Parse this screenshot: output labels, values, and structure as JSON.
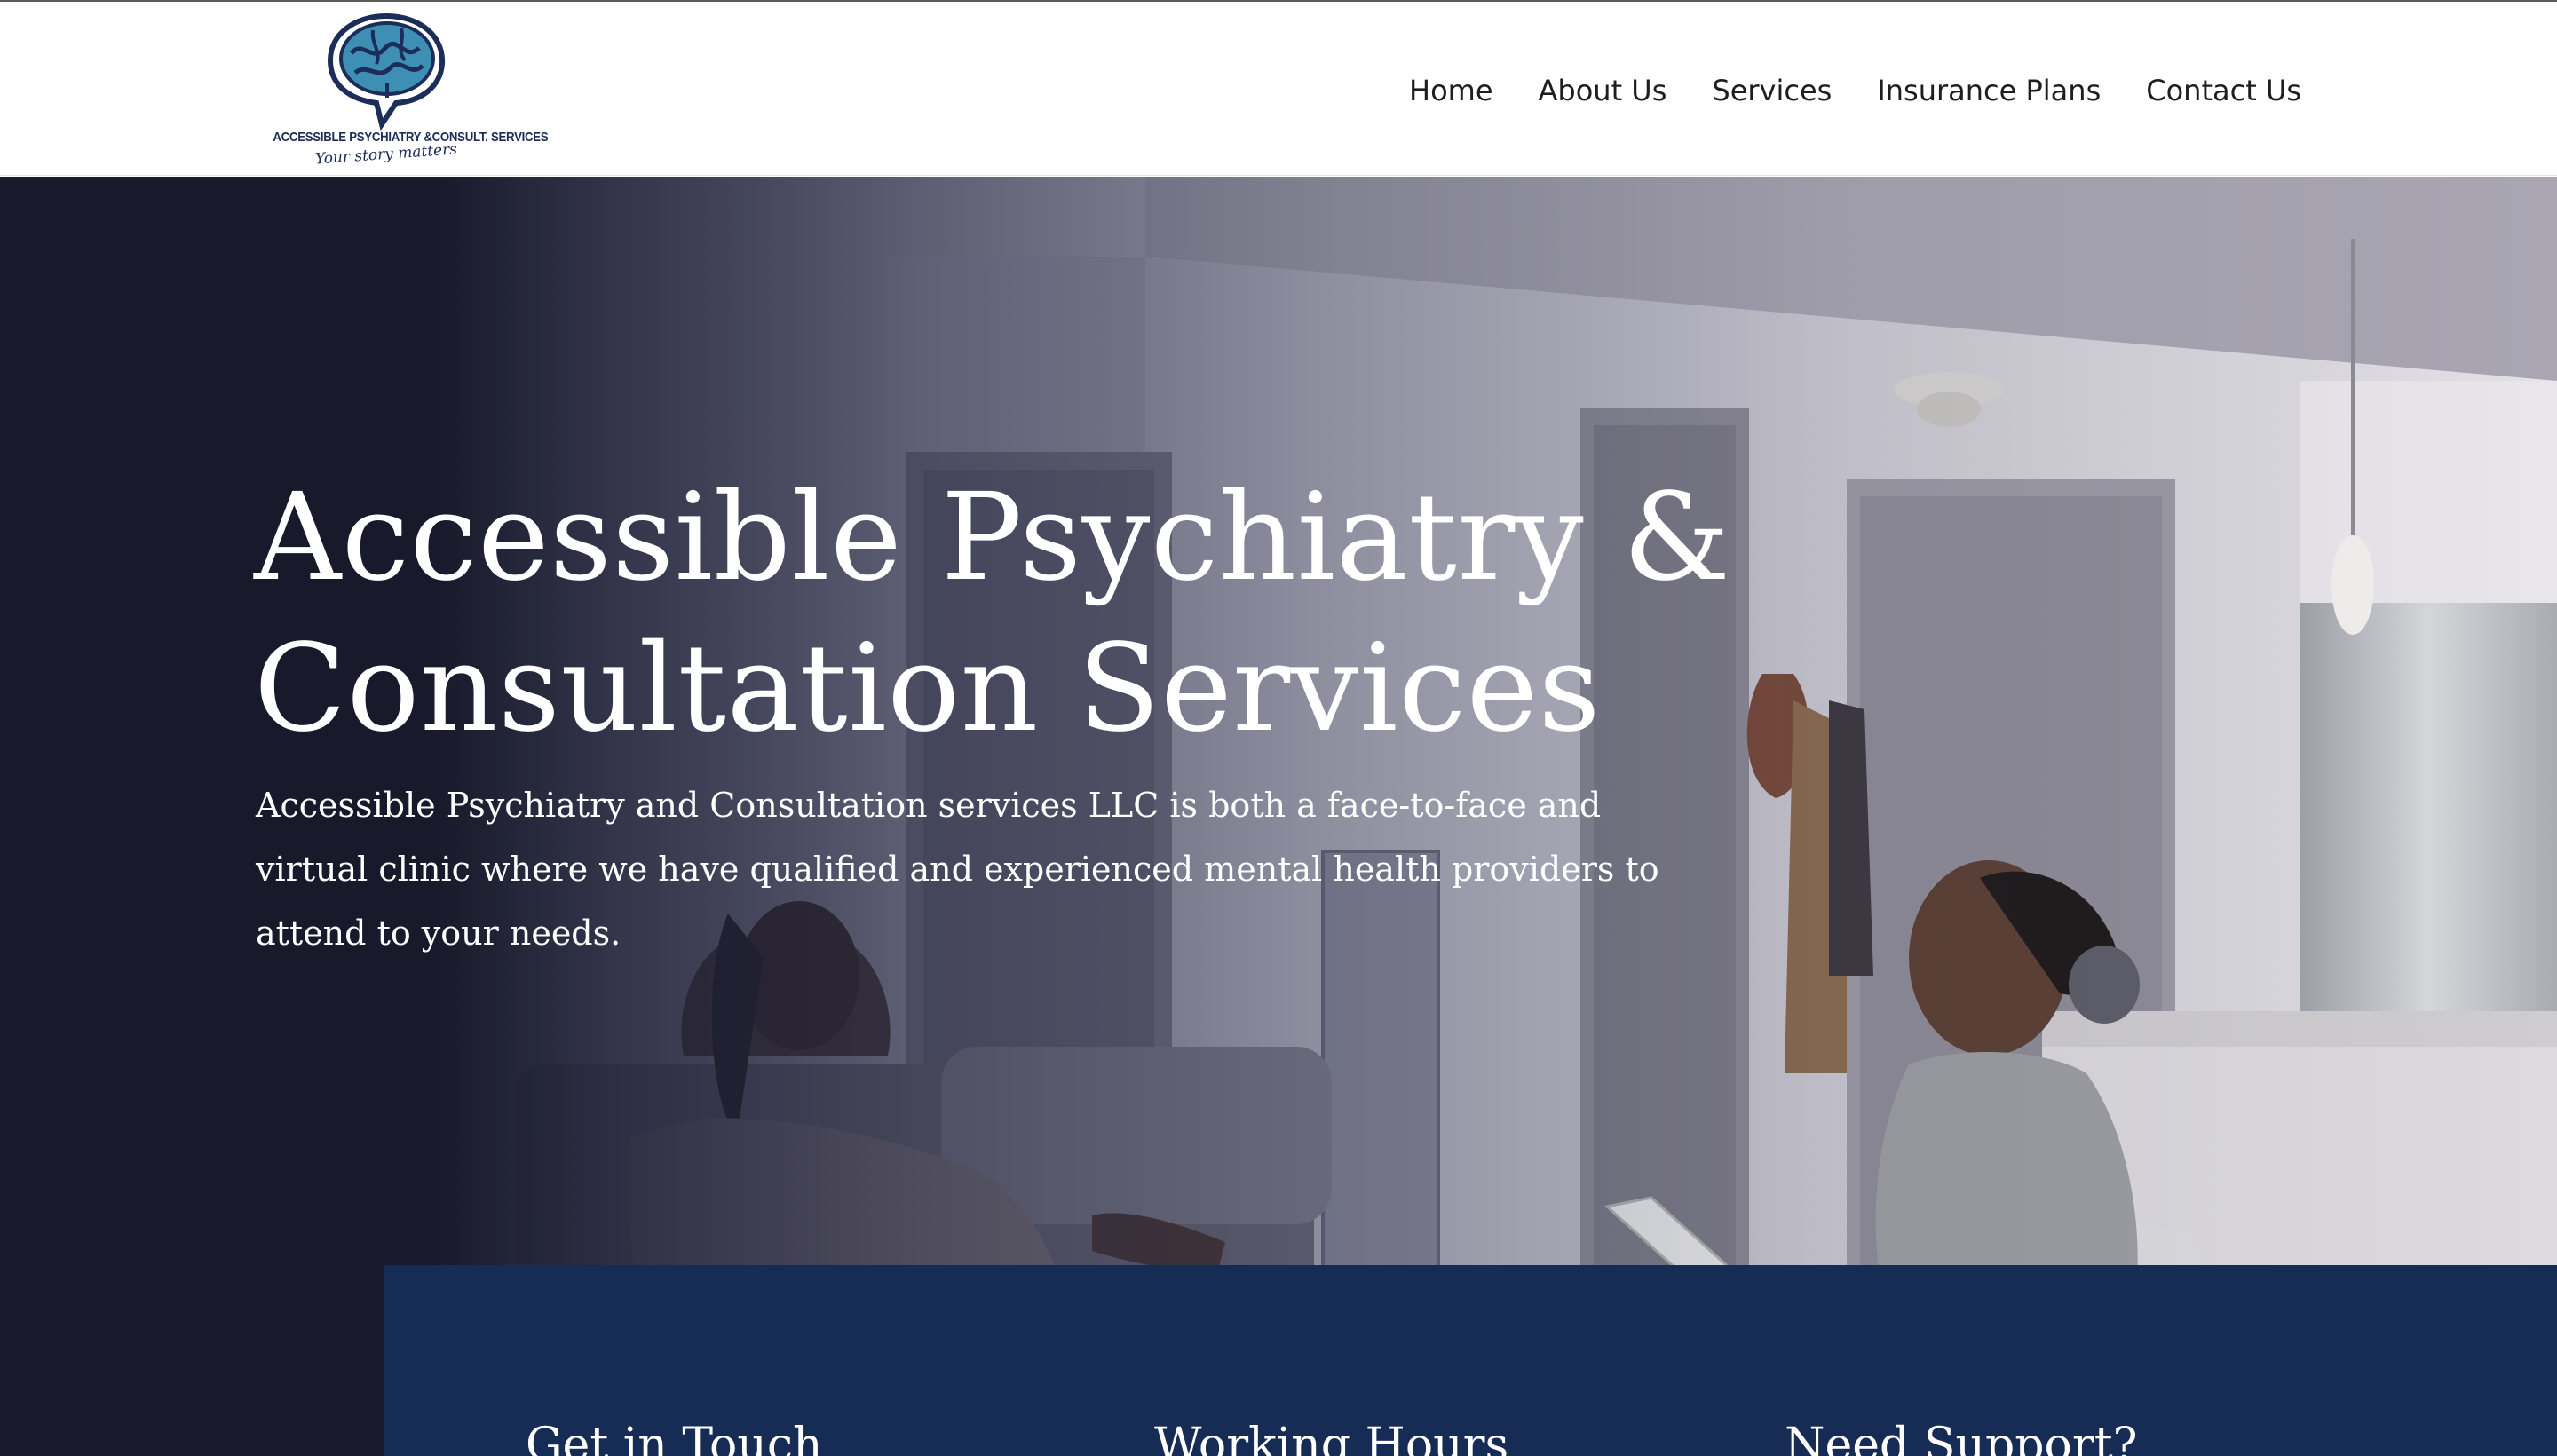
{
  "brand": {
    "name": "ACCESSIBLE PSYCHIATRY &CONSULT. SERVICES",
    "tagline": "Your story matters",
    "colors": {
      "navy": "#162c55",
      "logo_blue": "#3d8fb4",
      "logo_dark": "#1d2d5a"
    }
  },
  "nav": {
    "items": [
      {
        "label": "Home"
      },
      {
        "label": "About Us"
      },
      {
        "label": "Services"
      },
      {
        "label": "Insurance Plans"
      },
      {
        "label": "Contact Us"
      }
    ]
  },
  "hero": {
    "title_line1": "Accessible Psychiatry &",
    "title_line2": "Consultation Services",
    "description": "Accessible Psychiatry and Consultation services LLC is both a face-to-face and virtual clinic where we have qualified and experienced mental health providers to attend to your needs."
  },
  "info": {
    "columns": [
      {
        "heading": "Get in Touch"
      },
      {
        "heading": "Working Hours"
      },
      {
        "heading": "Need Support?"
      }
    ]
  }
}
